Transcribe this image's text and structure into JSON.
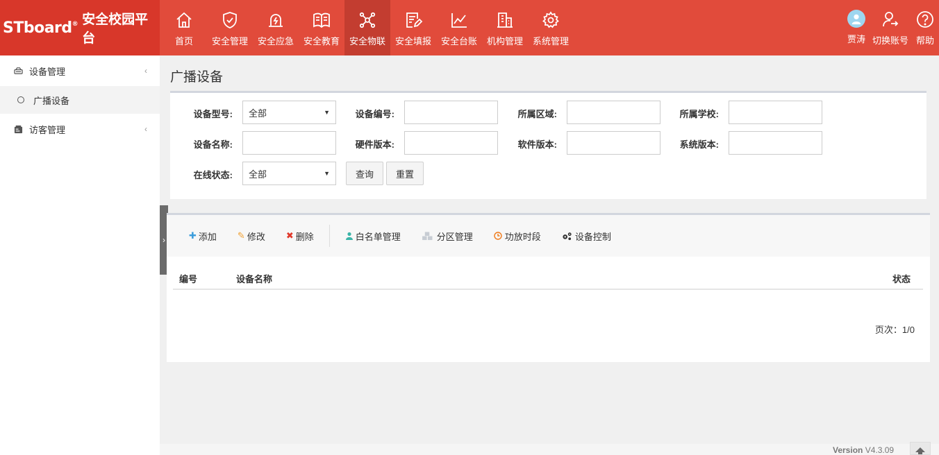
{
  "brand": {
    "logo_text": "STboard",
    "reg_mark": "®",
    "app_name": "安全校园平台"
  },
  "nav": [
    {
      "label": "首页",
      "icon": "home-icon"
    },
    {
      "label": "安全管理",
      "icon": "shield-check-icon"
    },
    {
      "label": "安全应急",
      "icon": "emergency-light-icon"
    },
    {
      "label": "安全教育",
      "icon": "book-icon"
    },
    {
      "label": "安全物联",
      "icon": "network-nodes-icon",
      "active": true
    },
    {
      "label": "安全填报",
      "icon": "form-edit-icon"
    },
    {
      "label": "安全台账",
      "icon": "line-chart-icon"
    },
    {
      "label": "机构管理",
      "icon": "building-icon"
    },
    {
      "label": "系统管理",
      "icon": "gear-icon"
    }
  ],
  "user_tools": {
    "user_name": "贾涛",
    "switch_label": "切换账号",
    "help_label": "帮助"
  },
  "sidebar": {
    "groups": [
      {
        "label": "设备管理",
        "icon": "device-icon",
        "children": [
          {
            "label": "广播设备",
            "active": true
          }
        ]
      },
      {
        "label": "访客管理",
        "icon": "visitor-icon",
        "children": []
      }
    ]
  },
  "page_title": "广播设备",
  "filters": {
    "device_type_label": "设备型号:",
    "device_type_value": "全部",
    "device_no_label": "设备编号:",
    "region_label": "所属区域:",
    "school_label": "所属学校:",
    "device_name_label": "设备名称:",
    "hw_version_label": "硬件版本:",
    "sw_version_label": "软件版本:",
    "sys_version_label": "系统版本:",
    "online_label": "在线状态:",
    "online_value": "全部",
    "query_button": "查询",
    "reset_button": "重置"
  },
  "toolbar": {
    "add": "添加",
    "edit": "修改",
    "delete": "删除",
    "whitelist": "白名单管理",
    "zone": "分区管理",
    "schedule": "功放时段",
    "control": "设备控制"
  },
  "table": {
    "columns": [
      "编号",
      "设备名称",
      "状态"
    ],
    "rows": []
  },
  "pager": "页次：1/0",
  "footer": {
    "version_label": "Version",
    "version_value": "V4.3.09"
  },
  "colors": {
    "header": "#e14b3b",
    "logo_bg": "#d8372a",
    "nav_active": "#c33d30",
    "add": "#3c9ddc",
    "edit": "#f0a030",
    "delete": "#e0392b",
    "whitelist": "#3bb4a8",
    "schedule": "#f07a1a"
  }
}
